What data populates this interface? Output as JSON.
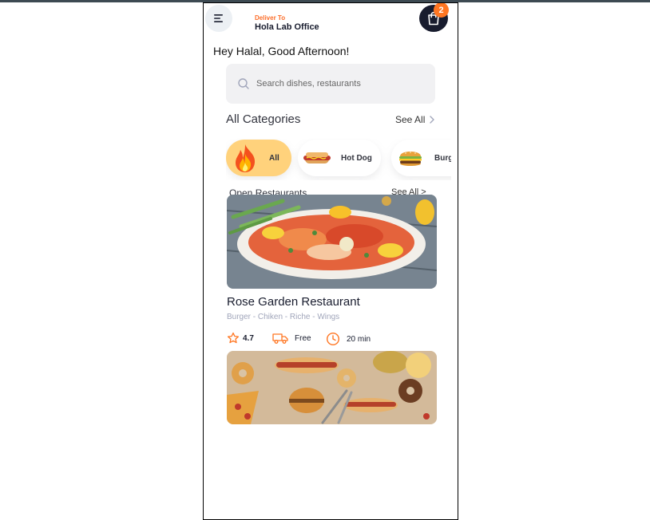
{
  "header": {
    "deliver_label": "Deliver To",
    "deliver_value": "Hola Lab Office",
    "cart_count": "2",
    "menu_icon": "menu-icon",
    "cart_icon": "shopping-bag-icon"
  },
  "greeting": "Hey Halal, Good Afternoon!",
  "search": {
    "placeholder": "Search dishes, restaurants"
  },
  "categories_section": {
    "title": "All Categories",
    "see_all": "See All",
    "items": [
      {
        "label": "All",
        "icon": "fire-icon",
        "active": true
      },
      {
        "label": "Hot Dog",
        "icon": "hot-dog-icon",
        "active": false
      },
      {
        "label": "Burg",
        "icon": "burger-icon",
        "active": false
      }
    ]
  },
  "open_restaurants": {
    "title": "Open Restaurants",
    "see_all": "See All >"
  },
  "restaurant": {
    "name": "Rose Garden Restaurant",
    "tags": "Burger - Chiken - Riche - Wings",
    "rating": "4.7",
    "delivery": "Free",
    "time": "20 min"
  },
  "colors": {
    "accent": "#FF7622",
    "category_active": "#FFD27C",
    "dark": "#181C2E"
  }
}
